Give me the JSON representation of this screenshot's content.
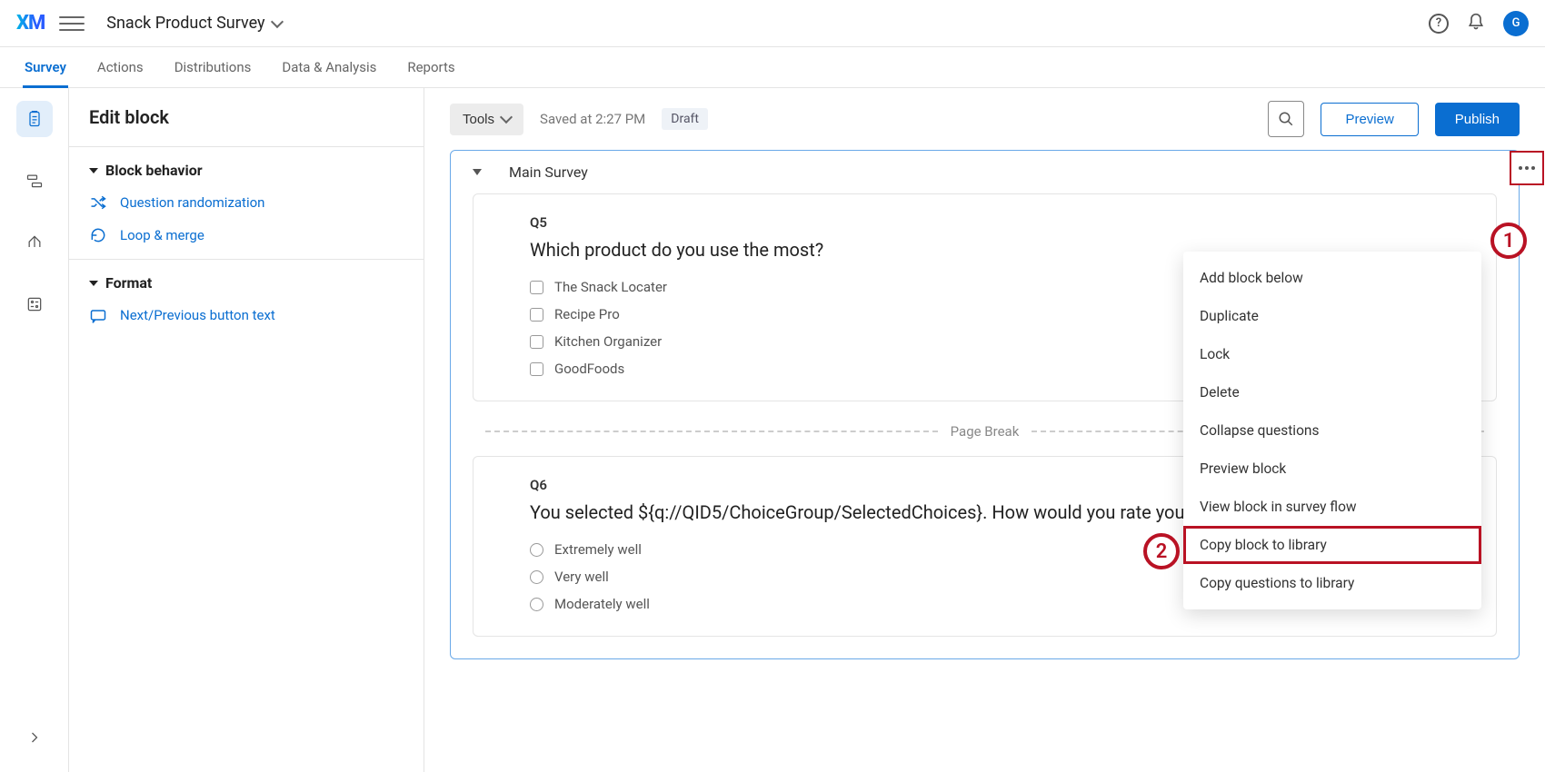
{
  "header": {
    "logo": "XM",
    "project_title": "Snack Product Survey",
    "avatar_initial": "G"
  },
  "nav": {
    "tabs": [
      "Survey",
      "Actions",
      "Distributions",
      "Data & Analysis",
      "Reports"
    ],
    "active_index": 0
  },
  "sidepanel": {
    "title": "Edit block",
    "sections": {
      "behavior": {
        "title": "Block behavior",
        "items": {
          "randomization": "Question randomization",
          "loop": "Loop & merge"
        }
      },
      "format": {
        "title": "Format",
        "items": {
          "nav_text": "Next/Previous button text"
        }
      }
    }
  },
  "toolbar": {
    "tools_label": "Tools",
    "saved_label": "Saved at 2:27 PM",
    "draft_label": "Draft",
    "preview_label": "Preview",
    "publish_label": "Publish"
  },
  "block": {
    "name": "Main Survey",
    "page_break_label": "Page Break",
    "questions": [
      {
        "id": "Q5",
        "text": "Which product do you use the most?",
        "type": "checkbox",
        "choices": [
          "The Snack Locater",
          "Recipe Pro",
          "Kitchen Organizer",
          "GoodFoods"
        ]
      },
      {
        "id": "Q6",
        "text": "You selected ${q://QID5/ChoiceGroup/SelectedChoices}. How would you rate your experience of this product?",
        "type": "radio",
        "choices": [
          "Extremely well",
          "Very well",
          "Moderately well"
        ]
      }
    ]
  },
  "dropdown": {
    "items": [
      "Add block below",
      "Duplicate",
      "Lock",
      "Delete",
      "Collapse questions",
      "Preview block",
      "View block in survey flow",
      "Copy block to library",
      "Copy questions to library"
    ],
    "highlight_index": 7
  },
  "callouts": {
    "c1": "1",
    "c2": "2"
  }
}
